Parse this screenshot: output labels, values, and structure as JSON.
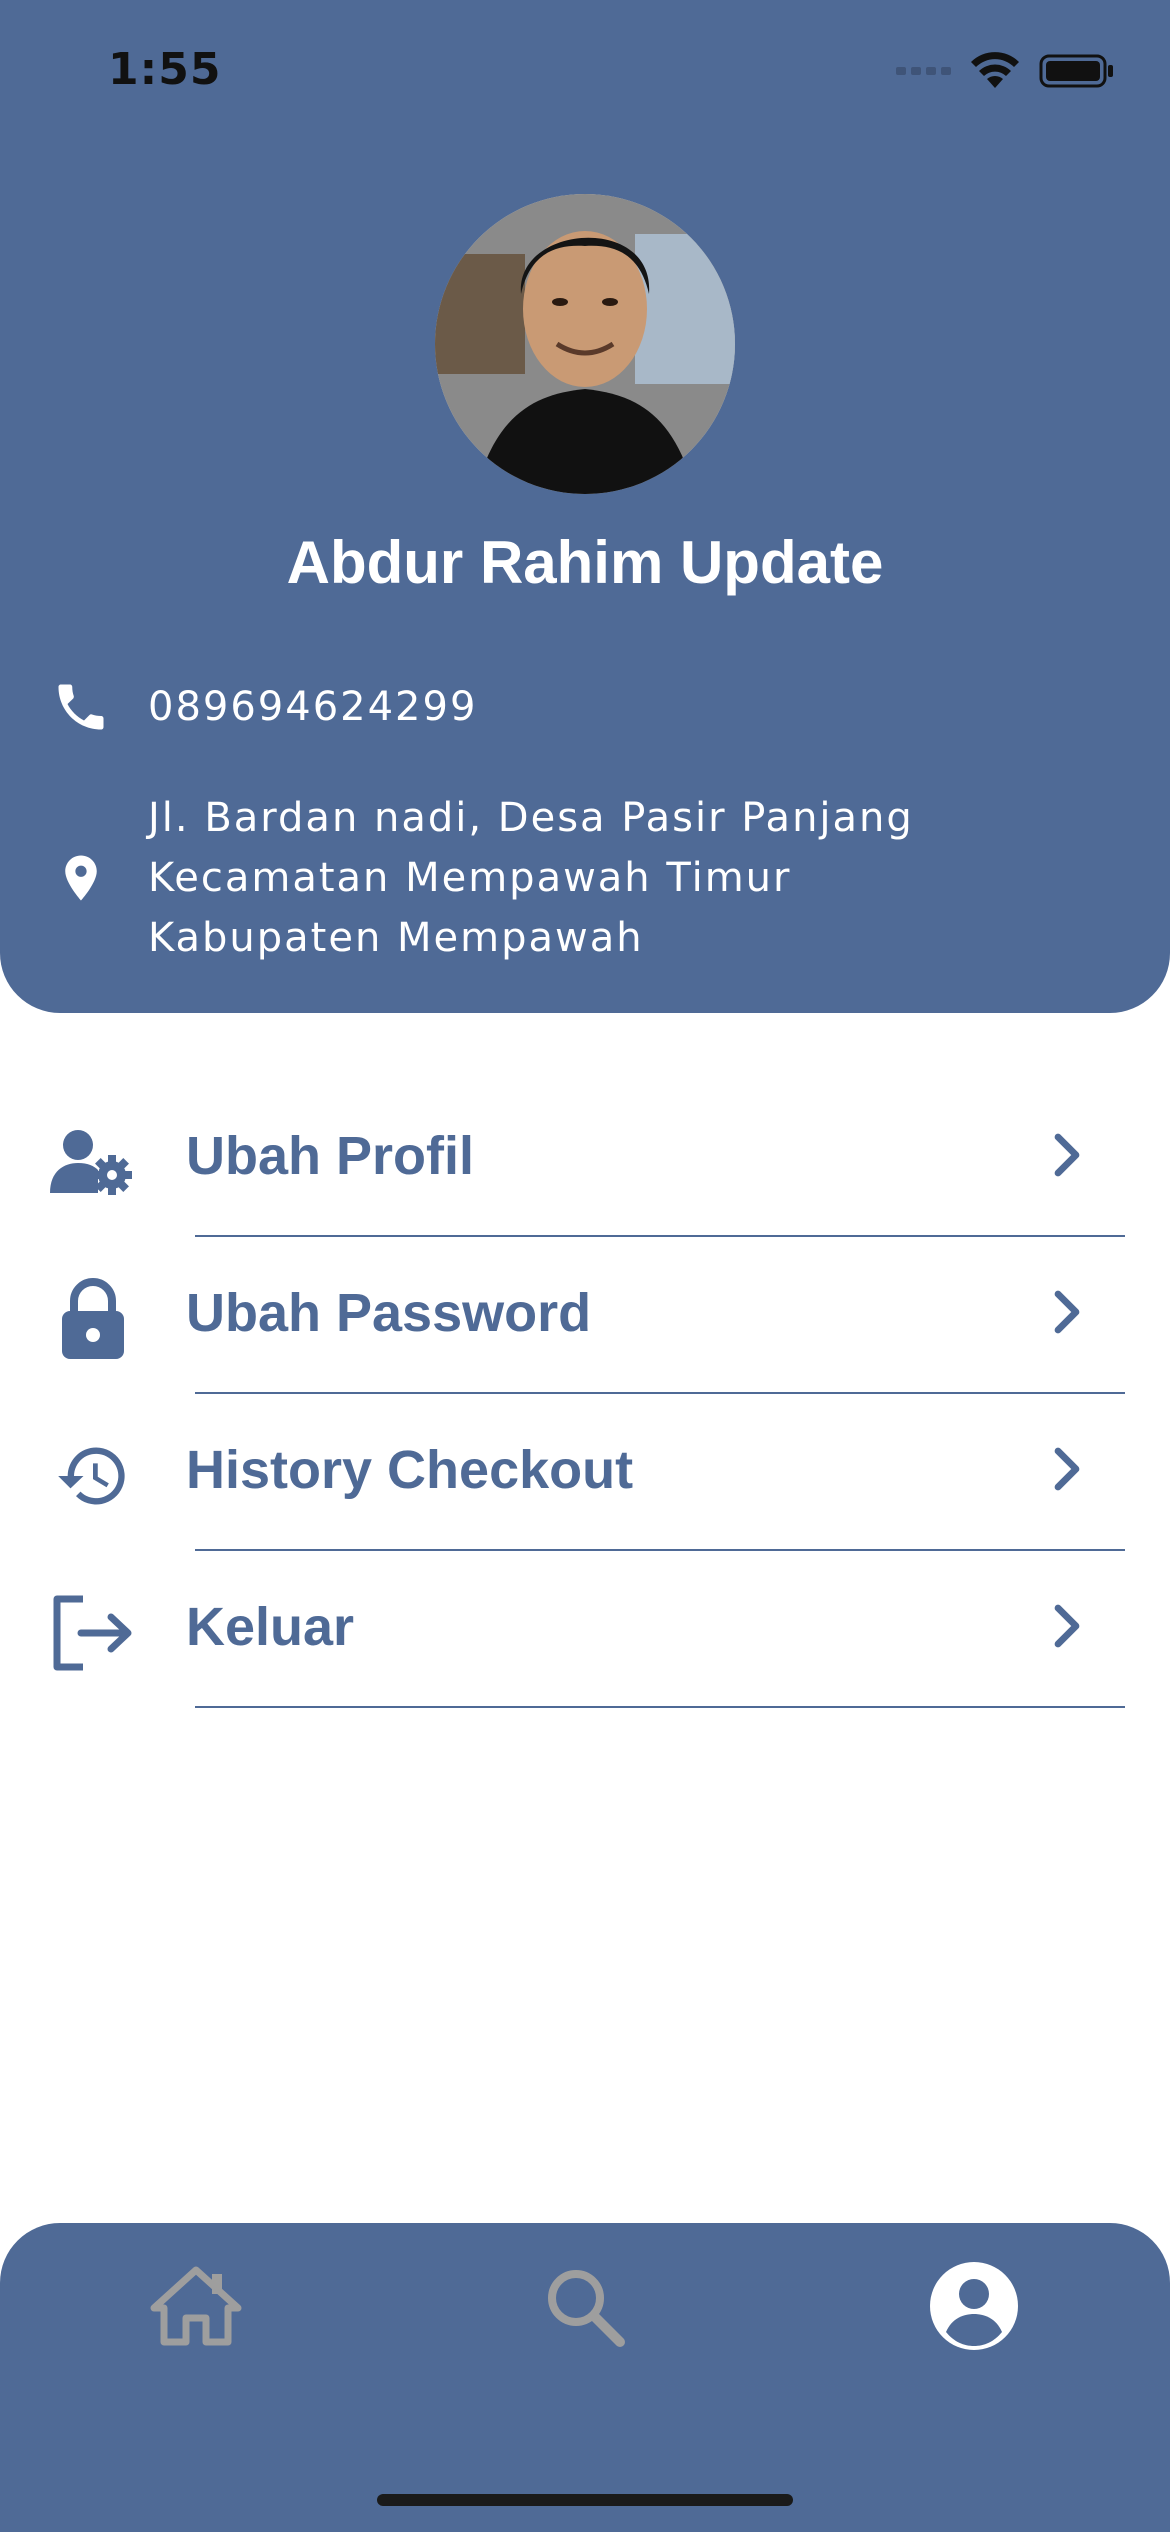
{
  "status_bar": {
    "time": "1:55"
  },
  "profile": {
    "name": "Abdur Rahim Update",
    "phone": "089694624299",
    "address": "Jl. Bardan nadi, Desa Pasir Panjang\nKecamatan Mempawah  Timur\nKabupaten Mempawah"
  },
  "menu": {
    "items": [
      {
        "label": "Ubah Profil",
        "icon": "user-cog-icon"
      },
      {
        "label": "Ubah Password",
        "icon": "lock-icon"
      },
      {
        "label": "History Checkout",
        "icon": "history-icon"
      },
      {
        "label": "Keluar",
        "icon": "logout-icon"
      }
    ]
  },
  "bottom_nav": {
    "items": [
      {
        "icon": "home-icon",
        "active": false
      },
      {
        "icon": "search-icon",
        "active": false
      },
      {
        "icon": "account-icon",
        "active": true
      }
    ]
  },
  "colors": {
    "primary": "#4F6A96",
    "white": "#FFFFFF",
    "inactive": "#9E9E9E"
  }
}
